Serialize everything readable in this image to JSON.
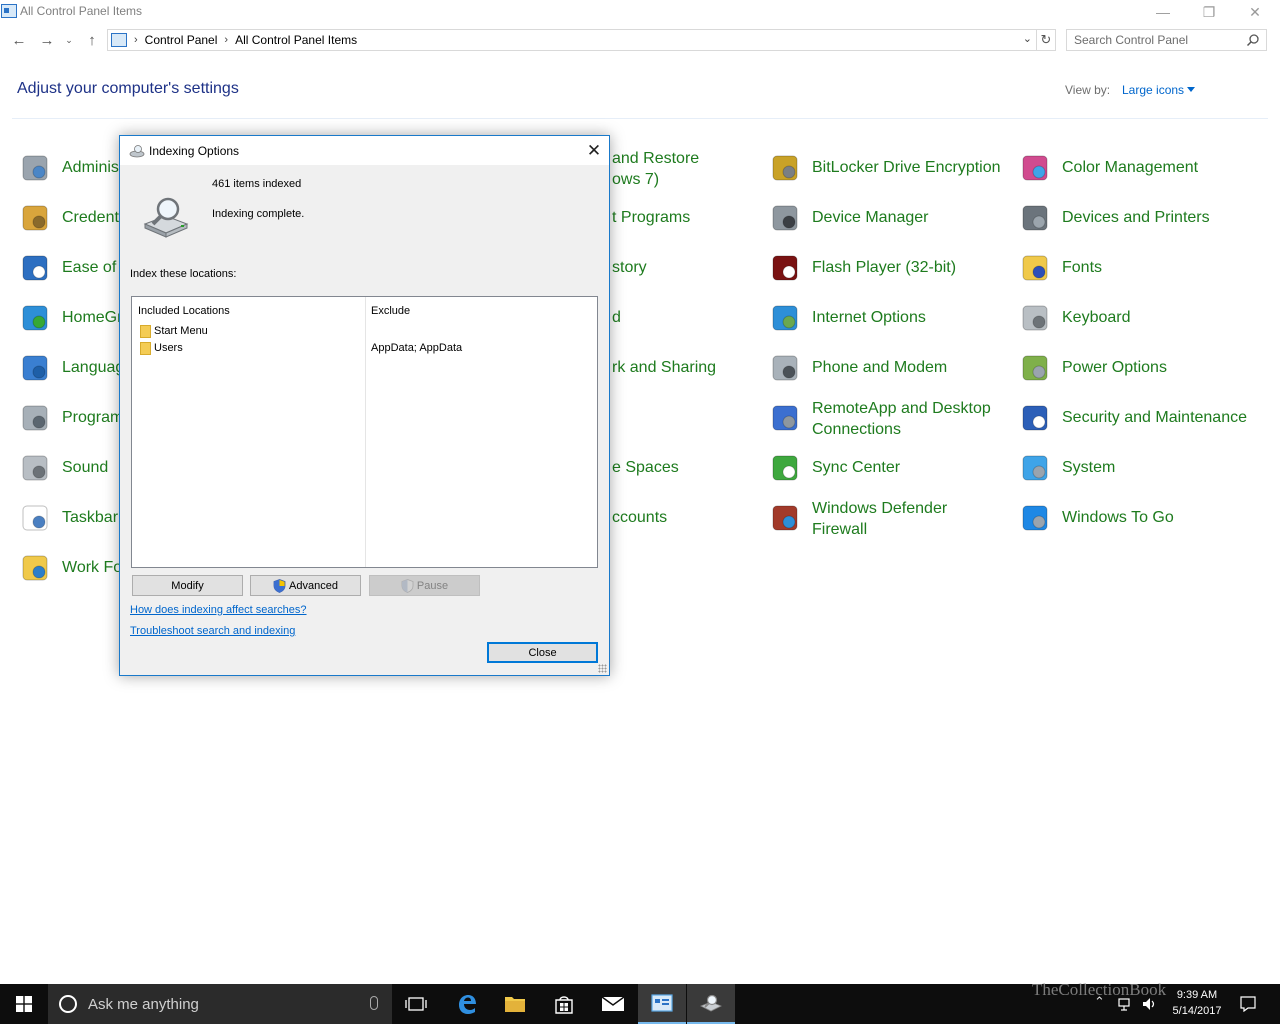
{
  "window": {
    "title": "All Control Panel Items"
  },
  "address": {
    "crumbs": [
      "Control Panel",
      "All Control Panel Items"
    ],
    "search_placeholder": "Search Control Panel"
  },
  "header": {
    "title": "Adjust your computer's settings",
    "view_by_label": "View by:",
    "view_by_value": "Large icons"
  },
  "items": [
    {
      "label": "Adminis",
      "icon": "administrative-tools-icon"
    },
    {
      "label": "Credenti",
      "icon": "credential-manager-icon"
    },
    {
      "label": "Ease of A",
      "icon": "ease-of-access-icon"
    },
    {
      "label": "HomeGr",
      "icon": "homegroup-icon"
    },
    {
      "label": "Languag",
      "icon": "language-icon"
    },
    {
      "label": "Program",
      "icon": "programs-icon"
    },
    {
      "label": "Sound",
      "icon": "sound-icon"
    },
    {
      "label": "Taskbar",
      "icon": "taskbar-icon"
    },
    {
      "label": "Work Fo",
      "icon": "work-folders-icon"
    },
    {
      "label": "and Restore",
      "label2": "ows 7)",
      "icon": "backup-restore-icon"
    },
    {
      "label": "t Programs",
      "icon": "default-programs-icon"
    },
    {
      "label": "story",
      "icon": "file-history-icon"
    },
    {
      "label": "d",
      "icon": "indexing-icon"
    },
    {
      "label": "rk and Sharing",
      "icon": "network-sharing-icon"
    },
    {
      "label": "e Spaces",
      "icon": "storage-spaces-icon"
    },
    {
      "label": "ccounts",
      "icon": "user-accounts-icon"
    },
    {
      "label": "BitLocker Drive Encryption",
      "icon": "bitlocker-icon"
    },
    {
      "label": "Device Manager",
      "icon": "device-manager-icon"
    },
    {
      "label": "Flash Player (32-bit)",
      "icon": "flash-player-icon"
    },
    {
      "label": "Internet Options",
      "icon": "internet-options-icon"
    },
    {
      "label": "Phone and Modem",
      "icon": "phone-modem-icon"
    },
    {
      "label": "RemoteApp and Desktop",
      "label2": "Connections",
      "icon": "remoteapp-icon"
    },
    {
      "label": "Sync Center",
      "icon": "sync-center-icon"
    },
    {
      "label": "Windows Defender",
      "label2": "Firewall",
      "icon": "firewall-icon"
    },
    {
      "label": "Color Management",
      "icon": "color-management-icon"
    },
    {
      "label": "Devices and Printers",
      "icon": "devices-printers-icon"
    },
    {
      "label": "Fonts",
      "icon": "fonts-icon"
    },
    {
      "label": "Keyboard",
      "icon": "keyboard-icon"
    },
    {
      "label": "Power Options",
      "icon": "power-options-icon"
    },
    {
      "label": "Security and Maintenance",
      "icon": "security-maintenance-icon"
    },
    {
      "label": "System",
      "icon": "system-icon"
    },
    {
      "label": "Windows To Go",
      "icon": "windows-to-go-icon"
    }
  ],
  "dialog": {
    "title": "Indexing Options",
    "count": "461 items indexed",
    "status": "Indexing complete.",
    "index_label": "Index these locations:",
    "col_included": "Included Locations",
    "col_exclude": "Exclude",
    "rows": [
      {
        "name": "Start Menu",
        "exclude": ""
      },
      {
        "name": "Users",
        "exclude": "AppData; AppData"
      }
    ],
    "modify": "Modify",
    "advanced": "Advanced",
    "pause": "Pause",
    "link1": "How does indexing affect searches?",
    "link2": "Troubleshoot search and indexing",
    "close": "Close"
  },
  "taskbar": {
    "cortana_text": "Ask me anything",
    "time": "9:39 AM",
    "date": "5/14/2017",
    "watermark": "TheCollectionBook"
  }
}
